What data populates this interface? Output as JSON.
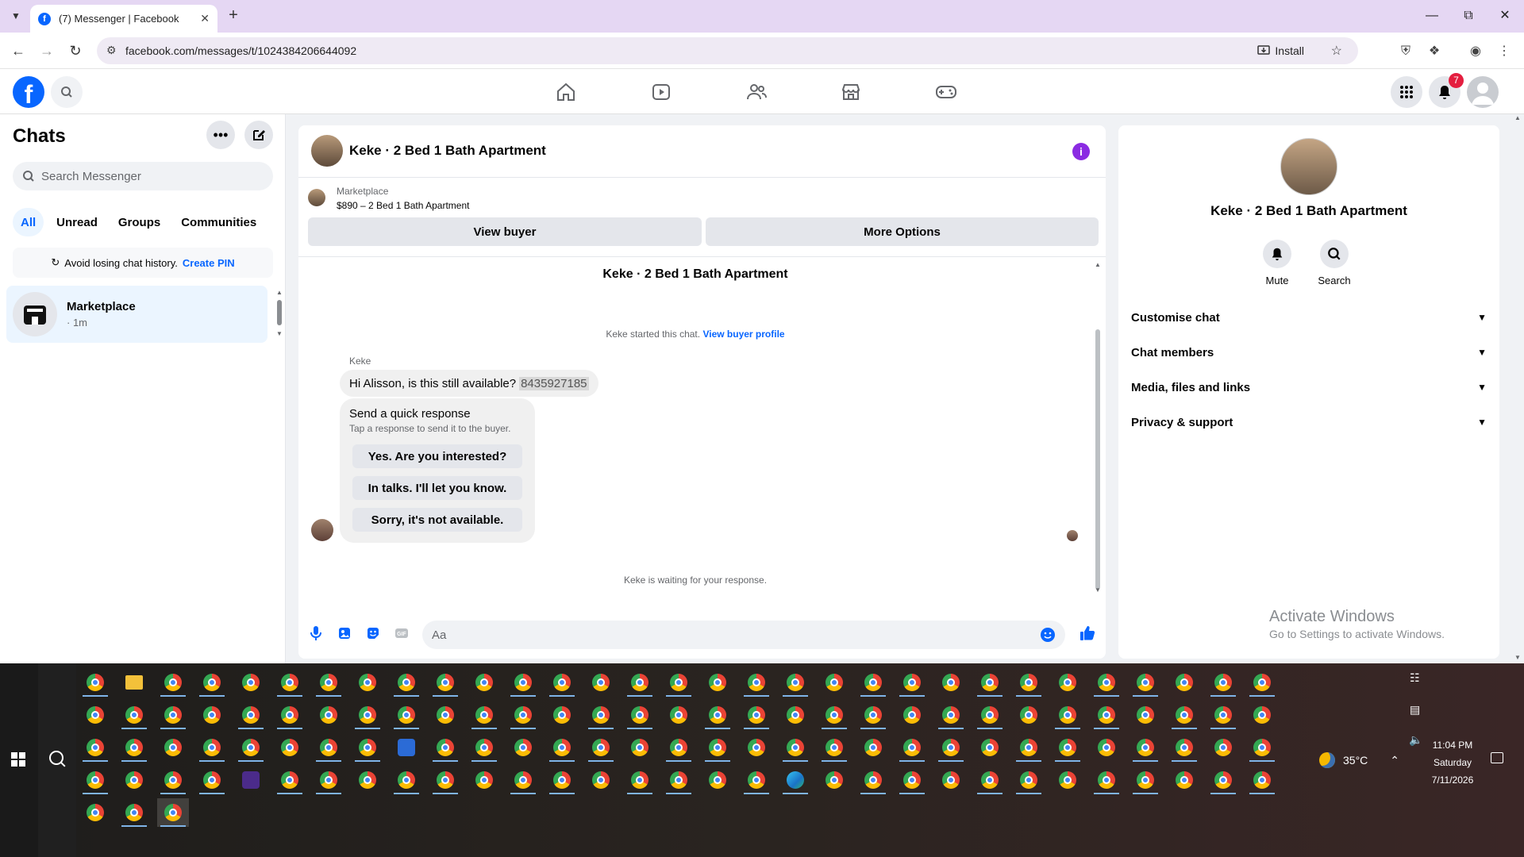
{
  "browser": {
    "tab_title": "(7) Messenger | Facebook",
    "url": "facebook.com/messages/t/1024384206644092",
    "install_label": "Install"
  },
  "fb_nav": {
    "notification_count": "7"
  },
  "left_pane": {
    "title": "Chats",
    "search_placeholder": "Search Messenger",
    "filters": [
      "All",
      "Unread",
      "Groups",
      "Communities"
    ],
    "pin_banner_text": "Avoid losing chat history.",
    "pin_banner_link": "Create PIN",
    "chat_name": "Marketplace",
    "chat_meta": "· 1m"
  },
  "conversation": {
    "header_title": "Keke · 2 Bed 1 Bath Apartment",
    "marketplace_label": "Marketplace",
    "listing_price_title": "$890 – 2 Bed 1 Bath Apartment",
    "view_buyer_label": "View buyer",
    "more_options_label": "More Options",
    "thread_title": "Keke · 2 Bed 1 Bath Apartment",
    "started_text": "Keke started this chat.",
    "started_link": "View buyer profile",
    "sender_name": "Keke",
    "message_text": "Hi Alisson, is this still available?",
    "message_phone": "8435927185",
    "quick_title": "Send a quick response",
    "quick_sub": "Tap a response to send it to the buyer.",
    "quick_responses": [
      "Yes. Are you interested?",
      "In talks. I'll let you know.",
      "Sorry, it's not available."
    ],
    "waiting_text": "Keke is waiting for your response.",
    "composer_placeholder": "Aa"
  },
  "right_pane": {
    "name": "Keke · 2 Bed 1 Bath Apartment",
    "mute_label": "Mute",
    "search_label": "Search",
    "sections": [
      "Customise chat",
      "Chat members",
      "Media, files and links",
      "Privacy & support"
    ],
    "activate_title": "Activate Windows",
    "activate_sub": "Go to Settings to activate Windows."
  },
  "taskbar": {
    "temperature": "35°C",
    "time": "11:04 PM",
    "day": "Saturday",
    "date": "7/11/2026"
  },
  "colors": {
    "fb_blue": "#0866ff",
    "badge_red": "#e41e3f",
    "info_purple": "#8a2be2",
    "tabstrip": "#e5d7f3"
  }
}
